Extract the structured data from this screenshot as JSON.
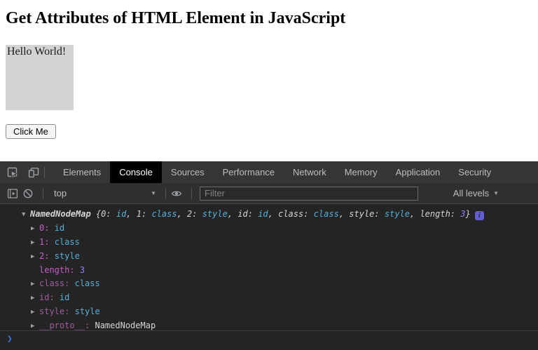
{
  "page": {
    "title": "Get Attributes of HTML Element in JavaScript",
    "box_text": "Hello World!",
    "box_color": "#d3d3d3",
    "button_label": "Click Me"
  },
  "devtools": {
    "tabs": [
      {
        "label": "Elements",
        "active": false
      },
      {
        "label": "Console",
        "active": true
      },
      {
        "label": "Sources",
        "active": false
      },
      {
        "label": "Performance",
        "active": false
      },
      {
        "label": "Network",
        "active": false
      },
      {
        "label": "Memory",
        "active": false
      },
      {
        "label": "Application",
        "active": false
      },
      {
        "label": "Security",
        "active": false
      }
    ],
    "tabbar_icons": [
      "inspect-element",
      "toggle-device-toolbar"
    ],
    "toolbar": {
      "icons": [
        "show-console-sidebar",
        "clear-console",
        "live-expression-eye"
      ],
      "context_label": "top",
      "filter_placeholder": "Filter",
      "levels_label": "All levels",
      "dropdown_arrow": "▼"
    },
    "console": {
      "preview": {
        "twisty": "▼",
        "constructor_name": "NamedNodeMap",
        "open_brace": " {",
        "close_brace": "}",
        "entries": [
          {
            "key": "0",
            "value": "id",
            "type": "node"
          },
          {
            "key": "1",
            "value": "class",
            "type": "node"
          },
          {
            "key": "2",
            "value": "style",
            "type": "node"
          },
          {
            "key": "id",
            "value": "id",
            "type": "node"
          },
          {
            "key": "class",
            "value": "class",
            "type": "node"
          },
          {
            "key": "style",
            "value": "style",
            "type": "node"
          },
          {
            "key": "length",
            "value": "3",
            "type": "number"
          }
        ],
        "info_badge": "i"
      },
      "rows": [
        {
          "twisty": "▶",
          "key": "0",
          "value": "id",
          "type": "node",
          "dim": false
        },
        {
          "twisty": "▶",
          "key": "1",
          "value": "class",
          "type": "node",
          "dim": false
        },
        {
          "twisty": "▶",
          "key": "2",
          "value": "style",
          "type": "node",
          "dim": false
        },
        {
          "twisty": "",
          "key": "length",
          "value": "3",
          "type": "number",
          "dim": false
        },
        {
          "twisty": "▶",
          "key": "class",
          "value": "class",
          "type": "node",
          "dim": true
        },
        {
          "twisty": "▶",
          "key": "id",
          "value": "id",
          "type": "node",
          "dim": true
        },
        {
          "twisty": "▶",
          "key": "style",
          "value": "style",
          "type": "node",
          "dim": true
        },
        {
          "twisty": "▶",
          "key": "__proto__",
          "value": "NamedNodeMap",
          "type": "plain",
          "dim": true
        }
      ],
      "prompt_symbol": "❯"
    },
    "colors": {
      "text": "#d5d5d5",
      "key_bright": "#c95ec9",
      "key_dim": "#a05ea0",
      "value_node": "#55b0d8",
      "value_number": "#9980ff",
      "badge_bg": "#5f5fd3",
      "accent_blue": "#3b78e0",
      "tabbar_bg": "#363636",
      "console_bg": "#242424"
    }
  }
}
